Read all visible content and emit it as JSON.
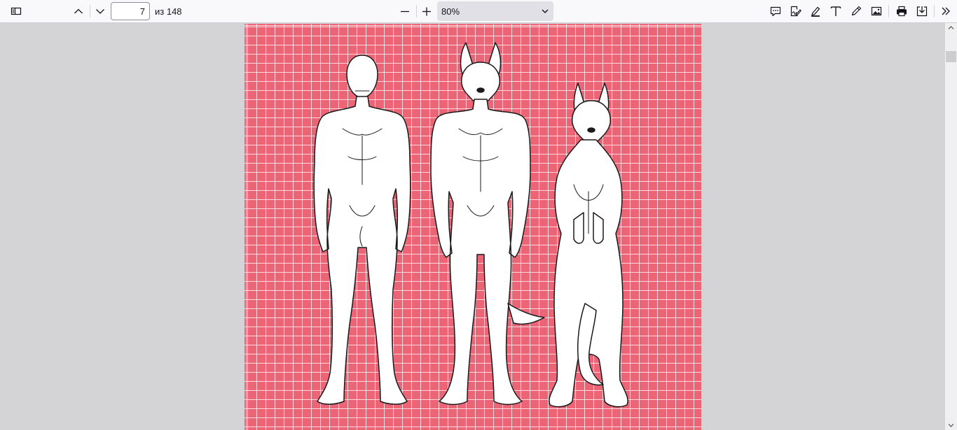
{
  "toolbar": {
    "page_number": "7",
    "page_count_label": "из 148",
    "zoom": {
      "selected": "80%"
    },
    "icons": {
      "sidebar": "sidebar-toggle-icon",
      "previous": "chevron-up-icon",
      "next": "chevron-down-icon",
      "zoom_out": "minus-icon",
      "zoom_in": "plus-icon",
      "zoom_dropdown": "chevron-down-icon",
      "comment": "comment-icon",
      "signature": "signature-icon",
      "highlight": "highlighter-icon",
      "text": "text-icon",
      "draw": "pencil-icon",
      "image": "image-icon",
      "print": "printer-icon",
      "save": "download-icon",
      "more": "double-chevron-right-icon"
    }
  },
  "document": {
    "page_background": "#ec6576",
    "grid_color": "#ffffff",
    "figures": [
      "human-figure",
      "anthro-canine-figure",
      "feral-canine-figure"
    ]
  },
  "colors": {
    "toolbar_bg": "#f9f9fb",
    "viewer_bg": "#d4d4d6",
    "zoom_select_bg": "#e0e0e6"
  }
}
